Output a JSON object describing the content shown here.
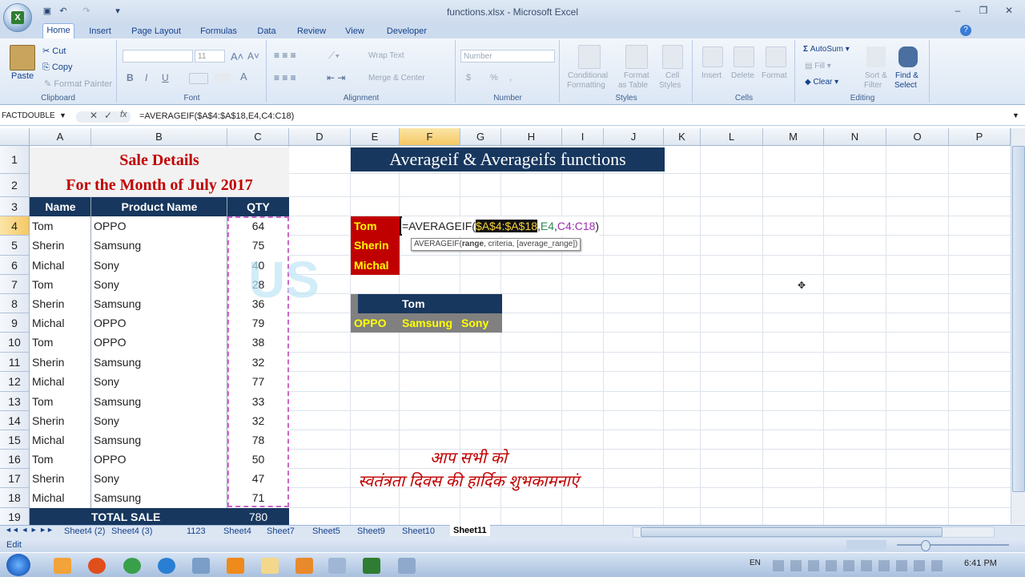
{
  "window": {
    "title": "functions.xlsx - Microsoft Excel",
    "minimize": "–",
    "restore": "❐",
    "close": "✕"
  },
  "ribbon_tabs": [
    "Home",
    "Insert",
    "Page Layout",
    "Formulas",
    "Data",
    "Review",
    "View",
    "Developer"
  ],
  "ribbon": {
    "clipboard": {
      "label": "Clipboard",
      "paste": "Paste",
      "cut": "Cut",
      "copy": "Copy",
      "format_painter": "Format Painter"
    },
    "font": {
      "label": "Font",
      "size": "11",
      "bold": "B",
      "italic": "I",
      "underline": "U"
    },
    "alignment": {
      "label": "Alignment",
      "wrap_text": "Wrap Text",
      "merge_center": "Merge & Center"
    },
    "number": {
      "label": "Number",
      "format": "Number",
      "currency": "$",
      "percent": "%",
      "comma": ","
    },
    "styles": {
      "label": "Styles",
      "conditional": "Conditional",
      "formatting": "Formatting",
      "format_as": "Format",
      "as_table": "as Table",
      "cell": "Cell",
      "styles_btn": "Styles"
    },
    "cells": {
      "label": "Cells",
      "insert": "Insert",
      "delete": "Delete",
      "format": "Format"
    },
    "editing": {
      "label": "Editing",
      "autosum": "AutoSum",
      "fill": "Fill",
      "clear": "Clear",
      "sort_filter": "Sort &",
      "filter": "Filter",
      "find_select": "Find &",
      "select": "Select"
    }
  },
  "formula_bar": {
    "name_box": "FACTDOUBLE",
    "fx": "fx",
    "formula": "=AVERAGEIF($A$4:$A$18,E4,C4:C18)"
  },
  "columns": [
    "A",
    "B",
    "C",
    "D",
    "E",
    "F",
    "G",
    "H",
    "I",
    "J",
    "K",
    "L",
    "M",
    "N",
    "O",
    "P"
  ],
  "rows": [
    "1",
    "2",
    "3",
    "4",
    "5",
    "6",
    "7",
    "8",
    "9",
    "10",
    "11",
    "12",
    "13",
    "14",
    "15",
    "16",
    "17",
    "18",
    "19"
  ],
  "sheet": {
    "title1": "Sale Details",
    "title2": "For the  Month of July 2017",
    "headers": [
      "Name",
      "Product Name",
      "QTY"
    ],
    "data": [
      [
        "Tom",
        "OPPO",
        "64"
      ],
      [
        "Sherin",
        "Samsung",
        "75"
      ],
      [
        "Michal",
        "Sony",
        "40"
      ],
      [
        "Tom",
        "Sony",
        "28"
      ],
      [
        "Sherin",
        "Samsung",
        "36"
      ],
      [
        "Michal",
        "OPPO",
        "79"
      ],
      [
        "Tom",
        "OPPO",
        "38"
      ],
      [
        "Sherin",
        "Samsung",
        "32"
      ],
      [
        "Michal",
        "Sony",
        "77"
      ],
      [
        "Tom",
        "Samsung",
        "33"
      ],
      [
        "Sherin",
        "Sony",
        "32"
      ],
      [
        "Michal",
        "Samsung",
        "78"
      ],
      [
        "Tom",
        "OPPO",
        "50"
      ],
      [
        "Sherin",
        "Sony",
        "47"
      ],
      [
        "Michal",
        "Samsung",
        "71"
      ]
    ],
    "total_label": "TOTAL SALE",
    "total_value": "780",
    "banner": "Averageif  & Averageifs functions",
    "names": [
      "Tom",
      "Sherin",
      "Michal"
    ],
    "edit_formula": {
      "prefix": "=AVERAGEIF(",
      "range": "$A$4:$A$18",
      "sep1": ",",
      "criteria": "E4",
      "sep2": ",",
      "avg_range": "C4:C18",
      "suffix": ")"
    },
    "tooltip": {
      "fn": "AVERAGEIF(",
      "arg1": "range",
      "rest": ", criteria, [average_range])"
    },
    "table2_header": "Tom",
    "table2_items": [
      "OPPO",
      "Samsung",
      "Sony"
    ],
    "hindi_line1": "आप सभी को",
    "hindi_line2": "स्वतंत्रता दिवस की हार्दिक शुभकामनाएं",
    "watermark": "US"
  },
  "sheet_tabs": [
    "Sheet4 (2)",
    "Sheet4 (3)",
    "1123",
    "Sheet4",
    "Sheet7",
    "Sheet5",
    "Sheet9",
    "Sheet10",
    "Sheet11"
  ],
  "active_sheet": "Sheet11",
  "status": {
    "mode": "Edit"
  },
  "taskbar": {
    "lang": "EN",
    "time": "6:41 PM"
  },
  "colors": {
    "navy": "#17375e",
    "title_red": "#c00000",
    "name_red": "#c00000",
    "yellow": "#ffff00",
    "gray": "#808080",
    "selection_pink": "#cc66cc"
  }
}
